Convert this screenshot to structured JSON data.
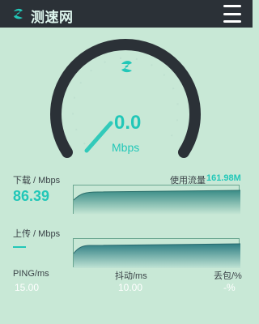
{
  "header": {
    "app_title": "测速网",
    "logo_icon": "s-swoosh-logo",
    "menu_icon": "hamburger-menu-icon"
  },
  "speed_gauge": {
    "center_icon": "s-swoosh-icon",
    "value": "0.0",
    "unit": "Mbps",
    "needle_level_fraction": 0.08
  },
  "download": {
    "label": "下载 / Mbps",
    "value": "86.39",
    "usage_label": "使用流量",
    "usage_value": "161.98M"
  },
  "upload": {
    "label": "上传 / Mbps",
    "value": "—"
  },
  "stats": {
    "ping_label": "PING/ms",
    "ping_value": "15.00",
    "jitter_label": "抖动/ms",
    "jitter_value": "10.00",
    "loss_label": "丢包/%",
    "loss_value": "-%"
  },
  "colors": {
    "background": "#c8e8d6",
    "header": "#2b3137",
    "accent": "#22c7b8",
    "gauge_arc": "#2b3137"
  }
}
